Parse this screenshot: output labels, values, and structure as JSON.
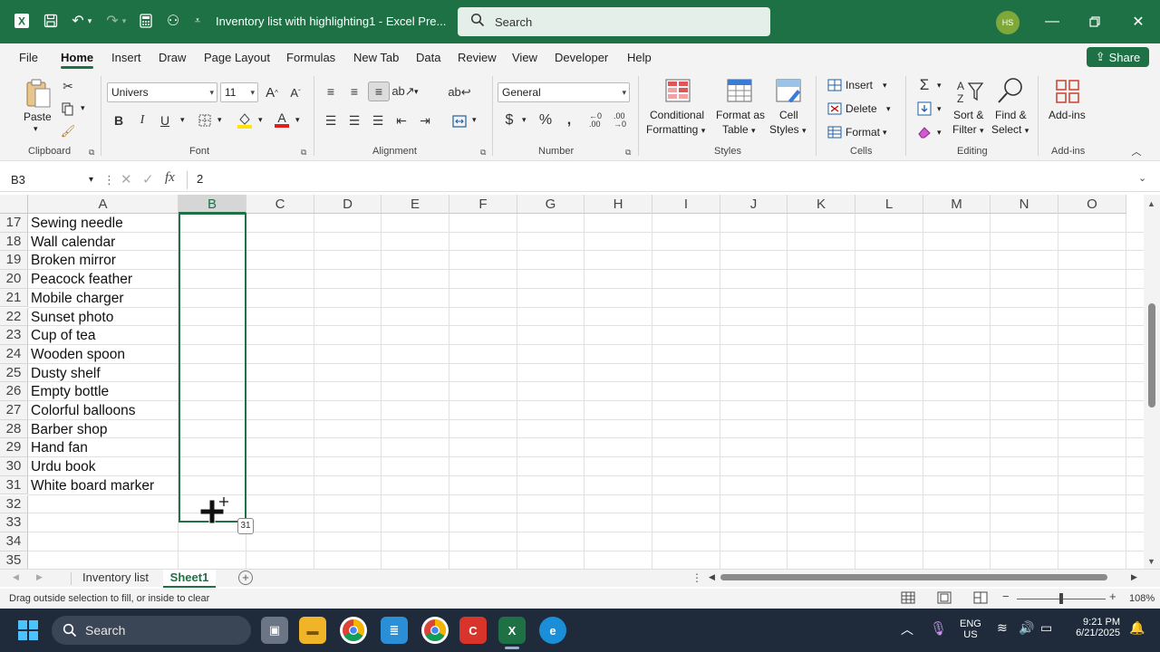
{
  "titlebar": {
    "doc_title": "Inventory list with highlighting1  -  Excel Pre...",
    "search_placeholder": "Search",
    "avatar_initials": "HS"
  },
  "menu": {
    "tabs": [
      "File",
      "Home",
      "Insert",
      "Draw",
      "Page Layout",
      "Formulas",
      "New Tab",
      "Data",
      "Review",
      "View",
      "Developer",
      "Help"
    ],
    "active": "Home",
    "share_label": "Share"
  },
  "ribbon": {
    "clipboard": {
      "label": "Clipboard",
      "paste": "Paste"
    },
    "font": {
      "label": "Font",
      "family": "Univers",
      "size": "11"
    },
    "alignment": {
      "label": "Alignment"
    },
    "number": {
      "label": "Number",
      "format": "General"
    },
    "styles": {
      "label": "Styles",
      "conditional": "Conditional",
      "formatting": "Formatting",
      "format_as": "Format as",
      "table": "Table",
      "cell": "Cell",
      "cell_styles": "Styles"
    },
    "cells": {
      "label": "Cells",
      "insert": "Insert",
      "delete": "Delete",
      "format": "Format"
    },
    "editing": {
      "label": "Editing",
      "sort": "Sort &",
      "filter": "Filter",
      "find": "Find &",
      "select": "Select"
    },
    "addins": {
      "label": "Add-ins",
      "addins_btn": "Add-ins"
    }
  },
  "formula_bar": {
    "name_box": "B3",
    "value": "2"
  },
  "grid": {
    "columns": [
      "A",
      "B",
      "C",
      "D",
      "E",
      "F",
      "G",
      "H",
      "I",
      "J",
      "K",
      "L",
      "M",
      "N",
      "O"
    ],
    "selected_column": "B",
    "rows": [
      {
        "num": "17",
        "a": "Sewing needle"
      },
      {
        "num": "18",
        "a": "Wall calendar"
      },
      {
        "num": "19",
        "a": "Broken mirror"
      },
      {
        "num": "20",
        "a": "Peacock feather"
      },
      {
        "num": "21",
        "a": "Mobile charger"
      },
      {
        "num": "22",
        "a": "Sunset photo"
      },
      {
        "num": "23",
        "a": "Cup of tea"
      },
      {
        "num": "24",
        "a": "Wooden spoon"
      },
      {
        "num": "25",
        "a": "Dusty shelf"
      },
      {
        "num": "26",
        "a": "Empty bottle"
      },
      {
        "num": "27",
        "a": "Colorful balloons"
      },
      {
        "num": "28",
        "a": "Barber shop"
      },
      {
        "num": "29",
        "a": "Hand fan"
      },
      {
        "num": "30",
        "a": "Urdu book"
      },
      {
        "num": "31",
        "a": "White board marker"
      },
      {
        "num": "32",
        "a": ""
      },
      {
        "num": "33",
        "a": ""
      },
      {
        "num": "34",
        "a": ""
      },
      {
        "num": "35",
        "a": ""
      }
    ],
    "fill_tooltip": "31"
  },
  "sheets": {
    "tabs": [
      "Inventory list",
      "Sheet1"
    ],
    "active": "Sheet1"
  },
  "status": {
    "message": "Drag outside selection to fill, or inside to clear",
    "zoom": "108%"
  },
  "taskbar": {
    "search": "Search",
    "lang_top": "ENG",
    "lang_bottom": "US",
    "time": "9:21 PM",
    "date": "6/21/2025"
  },
  "colors": {
    "accent": "#1e7145",
    "taskbar": "#1f2b3a"
  }
}
